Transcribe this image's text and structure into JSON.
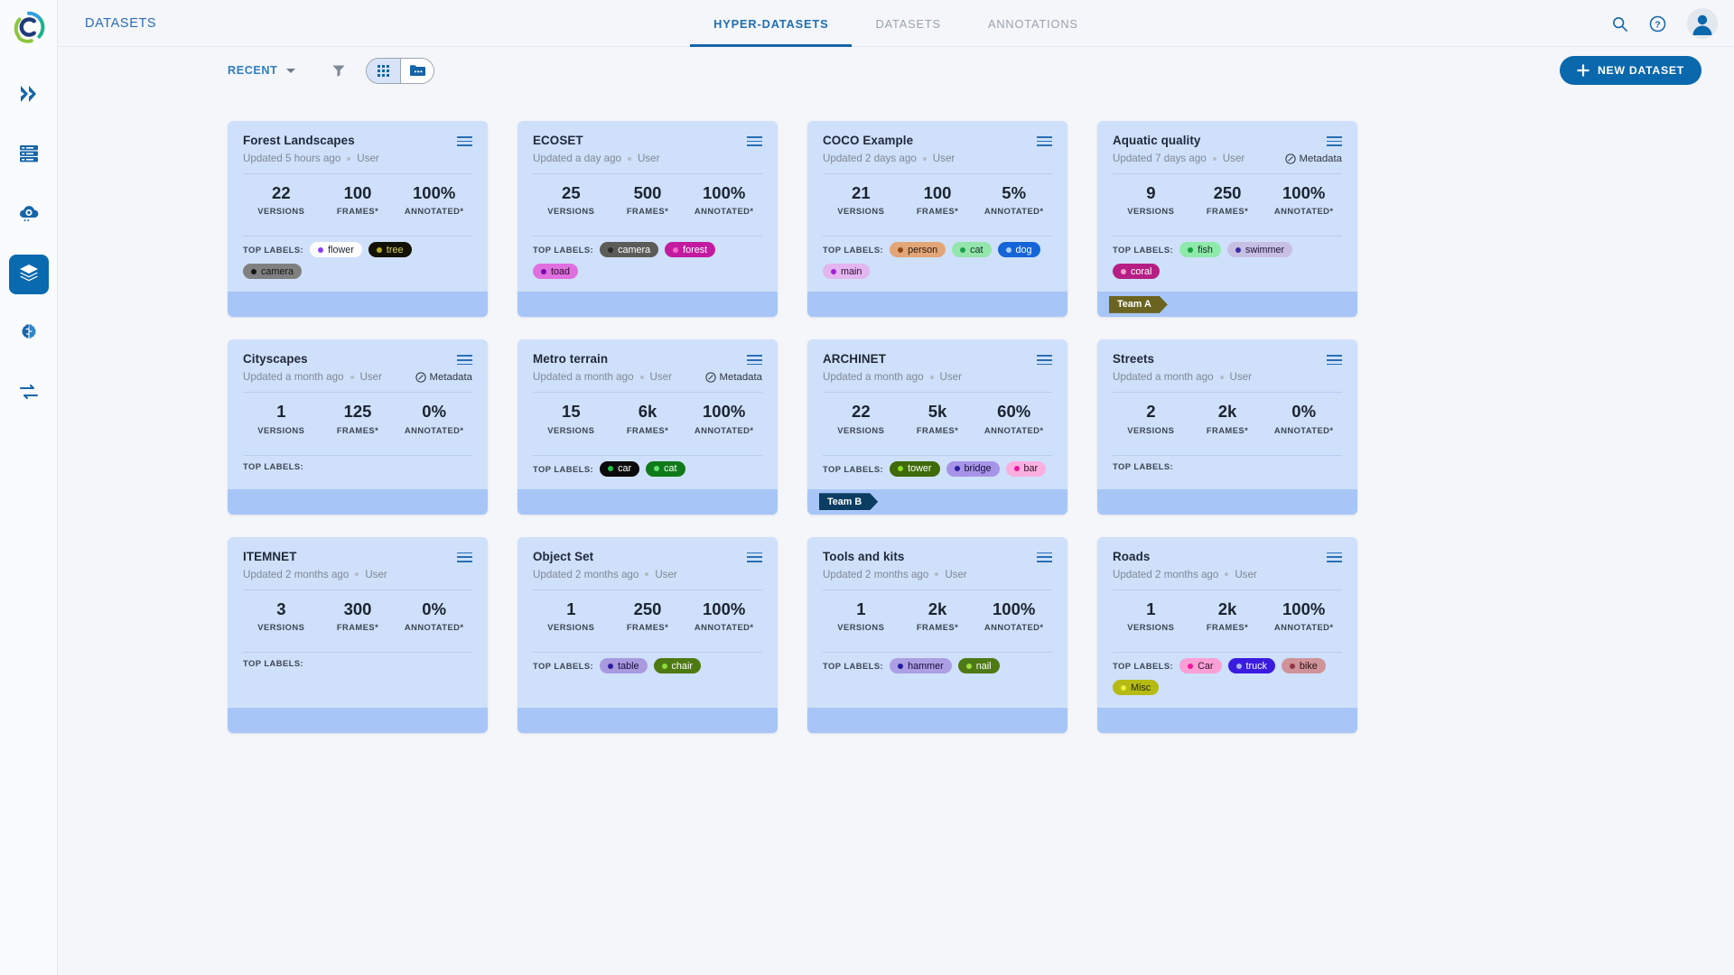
{
  "app": {
    "brand_icon": "clearml-logo-icon",
    "header_title": "DATASETS",
    "accent": "#0a68ad",
    "card_bg": "#cfe0fa",
    "card_footer_bg": "#a7c6f7"
  },
  "rail": {
    "items": [
      {
        "name": "pipelines-icon",
        "label": "Pipelines",
        "active": false
      },
      {
        "name": "datastores-icon",
        "label": "Data Stores",
        "active": false
      },
      {
        "name": "cloud-settings-icon",
        "label": "Cloud",
        "active": false
      },
      {
        "name": "layers-icon",
        "label": "Datasets",
        "active": true
      },
      {
        "name": "brain-icon",
        "label": "Models",
        "active": false
      },
      {
        "name": "workflows-icon",
        "label": "Workflows",
        "active": false
      }
    ]
  },
  "tabs": [
    {
      "label": "HYPER-DATASETS",
      "active": true
    },
    {
      "label": "DATASETS",
      "active": false
    },
    {
      "label": "ANNOTATIONS",
      "active": false
    }
  ],
  "topbar_right": [
    {
      "name": "search-icon",
      "label": "Search"
    },
    {
      "name": "help-icon",
      "label": "Help"
    },
    {
      "name": "avatar",
      "label": "Account"
    }
  ],
  "toolbar": {
    "sort_label": "RECENT",
    "filter_icon": "filter-icon",
    "views": [
      {
        "name": "grid-view-icon",
        "label": "Grid view",
        "active": true
      },
      {
        "name": "folder-view-icon",
        "label": "Folder view",
        "active": false
      }
    ],
    "new_dataset_label": "NEW DATASET",
    "new_dataset_plus": "+"
  },
  "stat_labels": {
    "versions": "VERSIONS",
    "frames": "FRAMES*",
    "annotated": "ANNOTATED*"
  },
  "top_labels_caption": "TOP LABELS:",
  "metadata_label": "Metadata",
  "cards": [
    {
      "title": "Forest Landscapes",
      "updated": "Updated 5 hours ago",
      "user": "User",
      "metadata": false,
      "versions": "22",
      "frames": "100",
      "annotated": "100%",
      "labels": [
        {
          "text": "flower",
          "bg": "#ffffff",
          "fg": "#1b2430",
          "dot": "#8b3ff0"
        },
        {
          "text": "tree",
          "bg": "#141204",
          "fg": "#d8d66a",
          "dot": "#b5b021"
        },
        {
          "text": "camera",
          "bg": "#808080",
          "fg": "#161616",
          "dot": "#141414"
        }
      ],
      "team": null
    },
    {
      "title": "ECOSET",
      "updated": "Updated a day ago",
      "user": "User",
      "metadata": false,
      "versions": "25",
      "frames": "500",
      "annotated": "100%",
      "labels": [
        {
          "text": "camera",
          "bg": "#5c5c58",
          "fg": "#ffffff",
          "dot": "#2b2b2b"
        },
        {
          "text": "forest",
          "bg": "#c21ba0",
          "fg": "#ffffff",
          "dot": "#f06ad0"
        },
        {
          "text": "toad",
          "bg": "#e06fe0",
          "fg": "#2a0a2a",
          "dot": "#7a07a8"
        }
      ],
      "team": null
    },
    {
      "title": "COCO Example",
      "updated": "Updated 2 days ago",
      "user": "User",
      "metadata": false,
      "versions": "21",
      "frames": "100",
      "annotated": "5%",
      "labels": [
        {
          "text": "person",
          "bg": "#e2a678",
          "fg": "#2b1a0c",
          "dot": "#8c4a12"
        },
        {
          "text": "cat",
          "bg": "#93e5ac",
          "fg": "#11301c",
          "dot": "#1aa14a"
        },
        {
          "text": "dog",
          "bg": "#1565d8",
          "fg": "#ffffff",
          "dot": "#a8cef5"
        },
        {
          "text": "main",
          "bg": "#e3b6ef",
          "fg": "#2b0c35",
          "dot": "#a21fd8"
        }
      ],
      "team": null
    },
    {
      "title": "Aquatic quality",
      "updated": "Updated 7 days ago",
      "user": "User",
      "metadata": true,
      "versions": "9",
      "frames": "250",
      "annotated": "100%",
      "labels": [
        {
          "text": "fish",
          "bg": "#8fe9ab",
          "fg": "#0f2e1a",
          "dot": "#169e3e"
        },
        {
          "text": "swimmer",
          "bg": "#c8c0e2",
          "fg": "#1c1438",
          "dot": "#3a2fa8"
        },
        {
          "text": "coral",
          "bg": "#b51f83",
          "fg": "#ffffff",
          "dot": "#f09ed0"
        }
      ],
      "team": {
        "text": "Team A",
        "bg": "#6b6420",
        "fg": "#ffffff"
      }
    },
    {
      "title": "Cityscapes",
      "updated": "Updated a month ago",
      "user": "User",
      "metadata": true,
      "versions": "1",
      "frames": "125",
      "annotated": "0%",
      "labels": [],
      "team": null
    },
    {
      "title": "Metro terrain",
      "updated": "Updated a month ago",
      "user": "User",
      "metadata": true,
      "versions": "15",
      "frames": "6k",
      "annotated": "100%",
      "labels": [
        {
          "text": "car",
          "bg": "#0b0b0b",
          "fg": "#ffffff",
          "dot": "#25c24a"
        },
        {
          "text": "cat",
          "bg": "#0f7a1a",
          "fg": "#ffffff",
          "dot": "#63e06f"
        }
      ],
      "team": null
    },
    {
      "title": "ARCHINET",
      "updated": "Updated a month ago",
      "user": "User",
      "metadata": false,
      "versions": "22",
      "frames": "5k",
      "annotated": "60%",
      "labels": [
        {
          "text": "tower",
          "bg": "#3f6b0a",
          "fg": "#ffffff",
          "dot": "#8ce024"
        },
        {
          "text": "bridge",
          "bg": "#a794e8",
          "fg": "#16103a",
          "dot": "#2a1f9e"
        },
        {
          "text": "bar",
          "bg": "#f9b0e0",
          "fg": "#32102a",
          "dot": "#e8189e"
        }
      ],
      "team": {
        "text": "Team B",
        "bg": "#0b3d62",
        "fg": "#ffffff"
      }
    },
    {
      "title": "Streets",
      "updated": "Updated a month ago",
      "user": "User",
      "metadata": false,
      "versions": "2",
      "frames": "2k",
      "annotated": "0%",
      "labels": [],
      "team": null
    },
    {
      "title": "ITEMNET",
      "updated": "Updated 2 months ago",
      "user": "User",
      "metadata": false,
      "versions": "3",
      "frames": "300",
      "annotated": "0%",
      "labels": [],
      "team": null
    },
    {
      "title": "Object Set",
      "updated": "Updated 2 months ago",
      "user": "User",
      "metadata": false,
      "versions": "1",
      "frames": "250",
      "annotated": "100%",
      "labels": [
        {
          "text": "table",
          "bg": "#a99ae0",
          "fg": "#140d3a",
          "dot": "#2b1fa0"
        },
        {
          "text": "chair",
          "bg": "#4e7a12",
          "fg": "#ffffff",
          "dot": "#8ddd3a"
        }
      ],
      "team": null
    },
    {
      "title": "Tools and kits",
      "updated": "Updated 2 months ago",
      "user": "User",
      "metadata": false,
      "versions": "1",
      "frames": "2k",
      "annotated": "100%",
      "labels": [
        {
          "text": "hammer",
          "bg": "#ad9fe3",
          "fg": "#150d3c",
          "dot": "#241a9e"
        },
        {
          "text": "nail",
          "bg": "#4d7a14",
          "fg": "#ffffff",
          "dot": "#9ce03a"
        }
      ],
      "team": null
    },
    {
      "title": "Roads",
      "updated": "Updated 2 months ago",
      "user": "User",
      "metadata": false,
      "versions": "1",
      "frames": "2k",
      "annotated": "100%",
      "labels": [
        {
          "text": "Car",
          "bg": "#f9a0d6",
          "fg": "#36112a",
          "dot": "#f0169e"
        },
        {
          "text": "truck",
          "bg": "#3a1be0",
          "fg": "#ffffff",
          "dot": "#a8b4f0"
        },
        {
          "text": "bike",
          "bg": "#cf9399",
          "fg": "#2a1012",
          "dot": "#8e3a44"
        },
        {
          "text": "Misc",
          "bg": "#b5bb12",
          "fg": "#24260a",
          "dot": "#e8f03a"
        }
      ],
      "team": null
    }
  ]
}
